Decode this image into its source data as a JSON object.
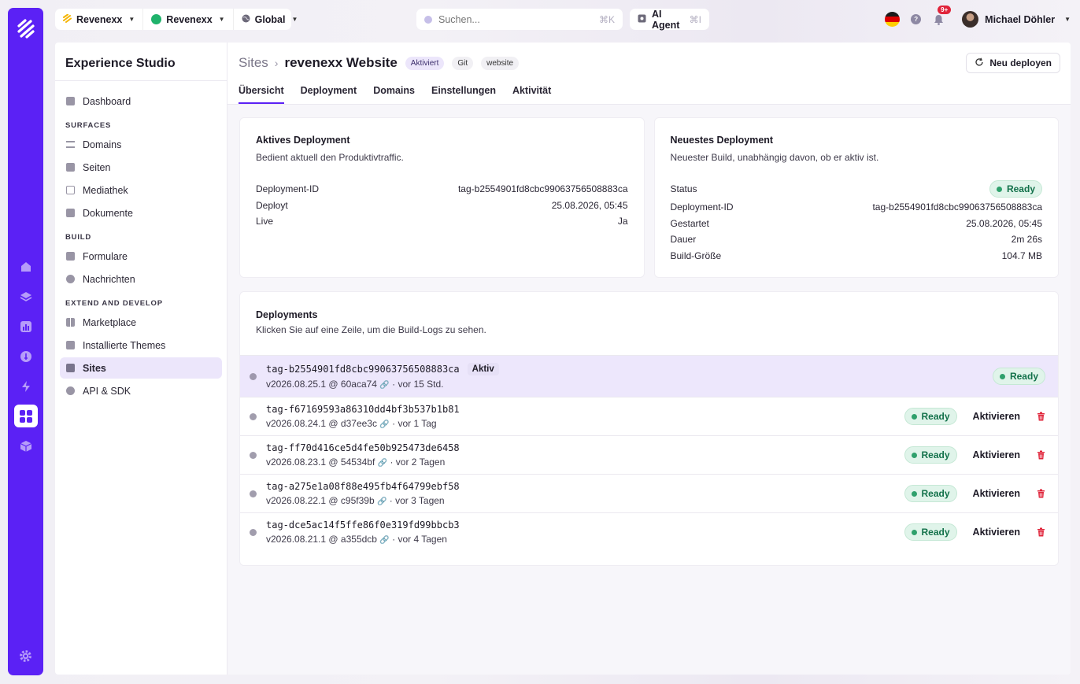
{
  "topbar": {
    "org1": "Revenexx",
    "org2": "Revenexx",
    "region": "Global",
    "search_placeholder": "Suchen...",
    "search_shortcut": "⌘K",
    "ai_label": "AI Agent",
    "ai_shortcut": "⌘I",
    "notifications_badge": "9+",
    "user_name": "Michael Döhler"
  },
  "sidebar": {
    "title": "Experience Studio",
    "dashboard": "Dashboard",
    "section_surfaces": "SURFACES",
    "domains": "Domains",
    "seiten": "Seiten",
    "mediathek": "Mediathek",
    "dokumente": "Dokumente",
    "section_build": "BUILD",
    "formulare": "Formulare",
    "nachrichten": "Nachrichten",
    "section_extend": "EXTEND AND DEVELOP",
    "marketplace": "Marketplace",
    "themes": "Installierte Themes",
    "sites": "Sites",
    "api": "API & SDK"
  },
  "header": {
    "crumb_root": "Sites",
    "site_name": "revenexx Website",
    "tag_status": "Aktiviert",
    "tag_git": "Git",
    "tag_type": "website",
    "deploy_button": "Neu deployen",
    "tabs": [
      "Übersicht",
      "Deployment",
      "Domains",
      "Einstellungen",
      "Aktivität"
    ]
  },
  "active_card": {
    "title": "Aktives Deployment",
    "subtitle": "Bedient aktuell den Produktivtraffic.",
    "id_label": "Deployment-ID",
    "id_value": "tag-b2554901fd8cbc99063756508883ca",
    "deployed_label": "Deployt",
    "deployed_value": "25.08.2026, 05:45",
    "live_label": "Live",
    "live_value": "Ja"
  },
  "latest_card": {
    "title": "Neuestes Deployment",
    "subtitle": "Neuester Build, unabhängig davon, ob er aktiv ist.",
    "status_label": "Status",
    "status_value": "Ready",
    "id_label": "Deployment-ID",
    "id_value": "tag-b2554901fd8cbc99063756508883ca",
    "started_label": "Gestartet",
    "started_value": "25.08.2026, 05:45",
    "duration_label": "Dauer",
    "duration_value": "2m 26s",
    "size_label": "Build-Größe",
    "size_value": "104.7 MB"
  },
  "deployments": {
    "title": "Deployments",
    "subtitle": "Klicken Sie auf eine Zeile, um die Build-Logs zu sehen.",
    "active_badge": "Aktiv",
    "activate_label": "Aktivieren",
    "rows": [
      {
        "id": "tag-b2554901fd8cbc99063756508883ca",
        "version": "v2026.08.25.1 @ 60aca74",
        "age": "· vor 15 Std.",
        "status": "Ready"
      },
      {
        "id": "tag-f67169593a86310dd4bf3b537b1b81",
        "version": "v2026.08.24.1 @ d37ee3c",
        "age": "· vor 1 Tag",
        "status": "Ready"
      },
      {
        "id": "tag-ff70d416ce5d4fe50b925473de6458",
        "version": "v2026.08.23.1 @ 54534bf",
        "age": "· vor 2 Tagen",
        "status": "Ready"
      },
      {
        "id": "tag-a275e1a08f88e495fb4f64799ebf58",
        "version": "v2026.08.22.1 @ c95f39b",
        "age": "· vor 3 Tagen",
        "status": "Ready"
      },
      {
        "id": "tag-dce5ac14f5ffe86f0e319fd99bbcb3",
        "version": "v2026.08.21.1 @ a355dcb",
        "age": "· vor 4 Tagen",
        "status": "Ready"
      }
    ]
  },
  "colors": {
    "brand": "#5b21f5",
    "ready_bg": "#e0f4ea",
    "ready_text": "#12714a",
    "danger": "#e0243a"
  }
}
